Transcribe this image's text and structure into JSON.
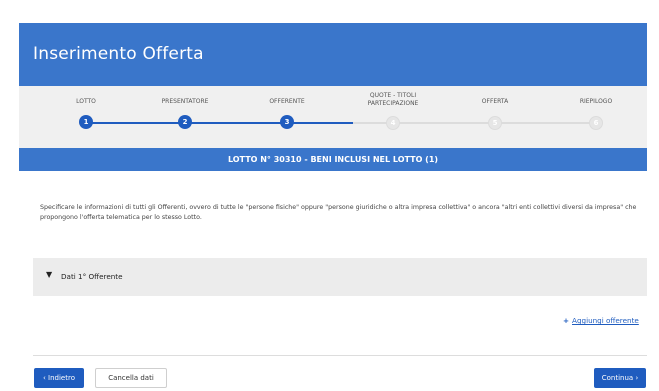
{
  "header": {
    "title": "Inserimento Offerta"
  },
  "stepper": {
    "steps": [
      {
        "label": "LOTTO",
        "number": "1",
        "state": "done"
      },
      {
        "label": "PRESENTATORE",
        "number": "2",
        "state": "done"
      },
      {
        "label": "OFFERENTE",
        "number": "3",
        "state": "done"
      },
      {
        "label": "QUOTE - TITOLI PARTECIPAZIONE",
        "number": "4",
        "state": "todo"
      },
      {
        "label": "OFFERTA",
        "number": "5",
        "state": "todo"
      },
      {
        "label": "RIEPILOGO",
        "number": "6",
        "state": "todo"
      }
    ]
  },
  "lot_bar": {
    "text": "LOTTO N° 30310  -  BENI INCLUSI NEL LOTTO  (1)"
  },
  "description": {
    "text": "Specificare le informazioni di tutti gli Offerenti, ovvero di tutte le \"persone fisiche\" oppure \"persone giuridiche o altra impresa collettiva\" o ancora \"altri enti collettivi diversi da impresa\" che propongono l'offerta telematica per lo stesso Lotto."
  },
  "accordion": {
    "title": "Dati 1° Offerente"
  },
  "actions": {
    "add_offerer": "Aggiungi offerente",
    "back": "Indietro",
    "clear": "Cancella dati",
    "next": "Continua"
  },
  "colors": {
    "primary": "#3a76cb",
    "step_active": "#1f5cbf",
    "step_inactive": "#e6e6e6"
  }
}
